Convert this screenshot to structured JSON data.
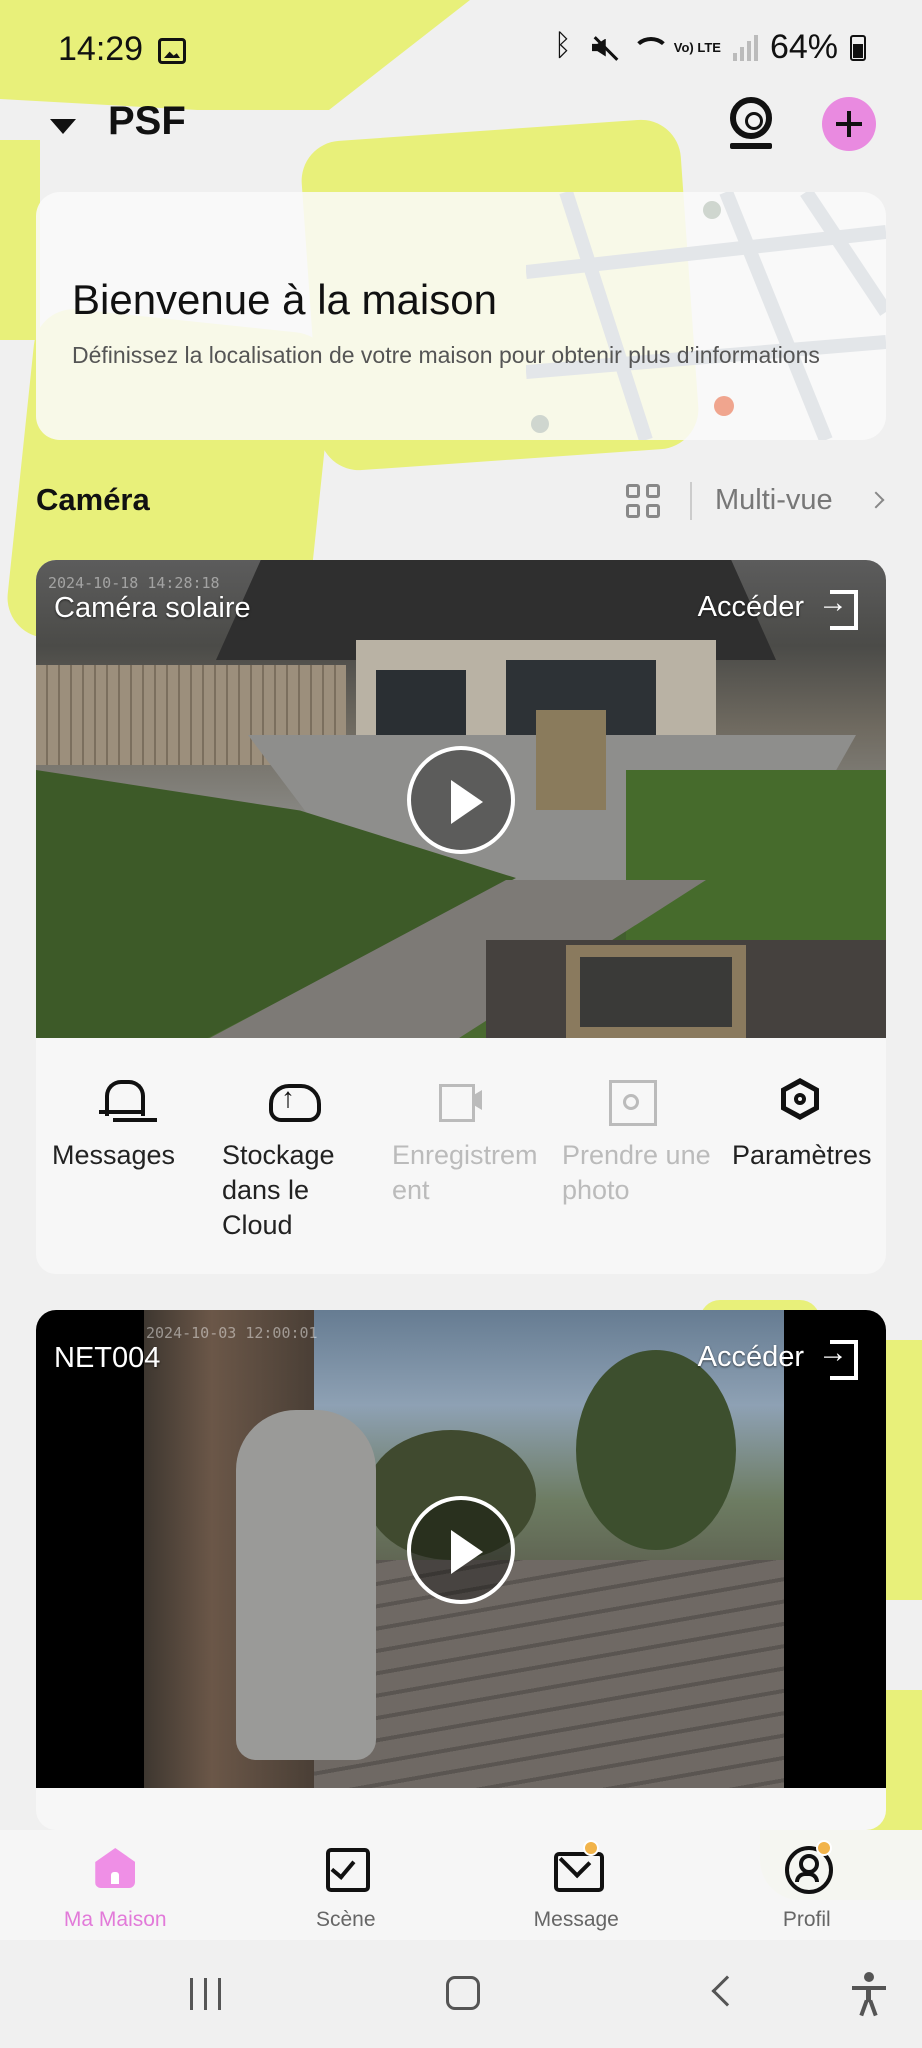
{
  "status_bar": {
    "time": "14:29",
    "network": "Vo) LTE",
    "battery": "64%",
    "icons": [
      "image-icon",
      "bluetooth-icon",
      "mute-icon",
      "wifi-icon",
      "signal-icon",
      "battery-icon"
    ]
  },
  "header": {
    "home_name": "PSF",
    "icons": [
      "dropdown-caret-icon",
      "camera-icon",
      "add-icon"
    ],
    "add_button_color": "#e98ae0"
  },
  "welcome": {
    "title": "Bienvenue à la maison",
    "subtitle": "Définissez la localisation de votre maison pour obtenir plus d’informations"
  },
  "camera_section": {
    "title": "Caméra",
    "multiview_label": "Multi-vue"
  },
  "cameras": [
    {
      "name": "Caméra solaire",
      "access_label": "Accéder",
      "timestamp": "2024-10-18 14:28:18",
      "actions": [
        {
          "label": "Messages",
          "icon": "bell-icon",
          "enabled": true
        },
        {
          "label": "Stockage dans le Cloud",
          "icon": "cloud-upload-icon",
          "enabled": true
        },
        {
          "label": "Enregistrement",
          "icon": "video-record-icon",
          "enabled": false
        },
        {
          "label": "Prendre une photo",
          "icon": "photo-icon",
          "enabled": false
        },
        {
          "label": "Paramètres",
          "icon": "settings-icon",
          "enabled": true
        }
      ]
    },
    {
      "name": "NET004",
      "access_label": "Accéder",
      "timestamp": "2024-10-03 12:00:01"
    }
  ],
  "bottom_nav": {
    "items": [
      {
        "label": "Ma Maison",
        "icon": "home-icon",
        "active": true
      },
      {
        "label": "Scène",
        "icon": "scene-checkbox-icon",
        "active": false
      },
      {
        "label": "Message",
        "icon": "mail-icon",
        "active": false,
        "badge": true
      },
      {
        "label": "Profil",
        "icon": "profile-icon",
        "active": false,
        "badge": true
      }
    ],
    "active_color": "#e27ad9",
    "badge_color": "#f2b44b"
  },
  "colors": {
    "background_accent": "#e8f07a"
  }
}
